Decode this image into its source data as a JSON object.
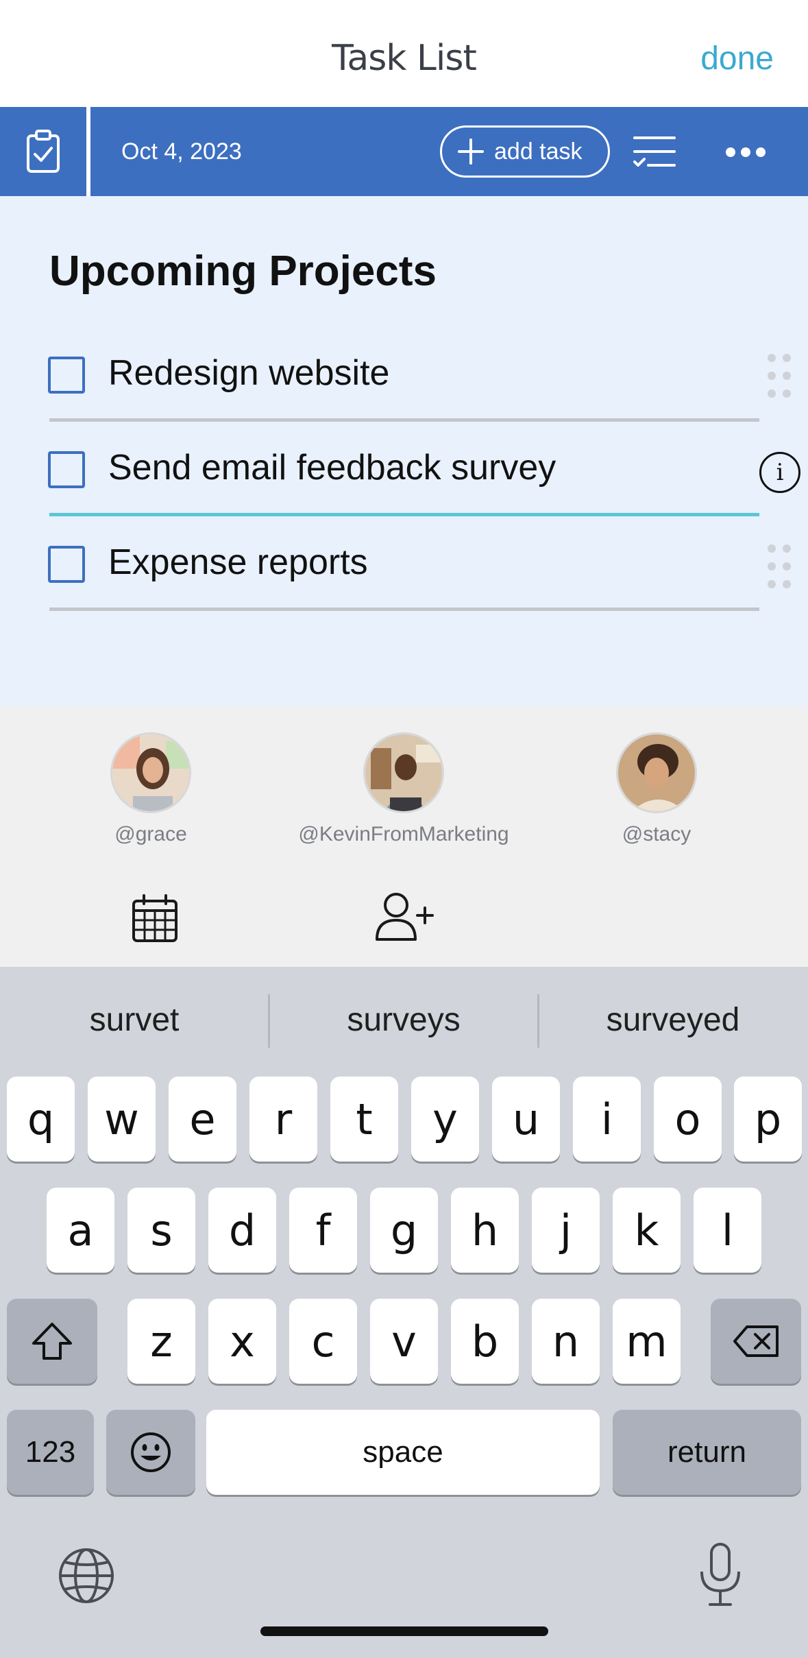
{
  "header": {
    "title": "Task List",
    "done_label": "done"
  },
  "toolbar": {
    "date": "Oct 4, 2023",
    "add_task_label": "add task",
    "color": "#3d6fc0"
  },
  "list": {
    "heading": "Upcoming Projects",
    "tasks": [
      {
        "label": "Redesign website",
        "checked": false
      },
      {
        "label": "Send email feedback survey",
        "checked": false,
        "editing": true
      },
      {
        "label": "Expense reports",
        "checked": false
      }
    ]
  },
  "mentions": {
    "people": [
      {
        "handle": "@grace"
      },
      {
        "handle": "@KevinFromMarketing"
      },
      {
        "handle": "@stacy"
      }
    ]
  },
  "keyboard": {
    "suggestions": [
      "survet",
      "surveys",
      "surveyed"
    ],
    "row1": [
      "q",
      "w",
      "e",
      "r",
      "t",
      "y",
      "u",
      "i",
      "o",
      "p"
    ],
    "row2": [
      "a",
      "s",
      "d",
      "f",
      "g",
      "h",
      "j",
      "k",
      "l"
    ],
    "row3": [
      "z",
      "x",
      "c",
      "v",
      "b",
      "n",
      "m"
    ],
    "numbers_label": "123",
    "space_label": "space",
    "return_label": "return"
  }
}
